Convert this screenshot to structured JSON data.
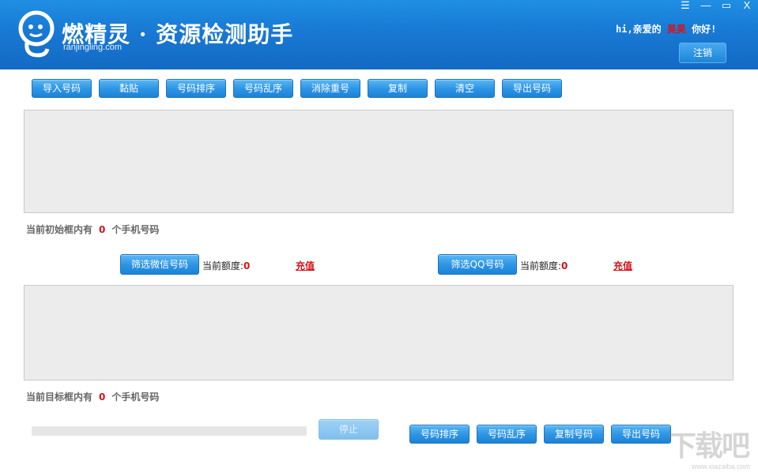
{
  "app": {
    "brand_name": "燃精灵 · 资源检测助手",
    "brand_domain": "ranjingling.com",
    "greeting_prefix": "hi,亲爱的",
    "username": "昊昊",
    "greeting_suffix": "你好!",
    "logout_label": "注销",
    "window_controls": {
      "menu": "☰",
      "minimize": "—",
      "maximize": "▭",
      "close": "X"
    }
  },
  "toolbar": {
    "import": "导入号码",
    "paste": "黏贴",
    "sort": "号码排序",
    "shuffle": "号码乱序",
    "dedupe": "消除重号",
    "copy": "复制",
    "clear": "清空",
    "export": "导出号码"
  },
  "source": {
    "textarea_value": "",
    "status_prefix": "当前初始框内有",
    "count": "0",
    "status_suffix": "个手机号码"
  },
  "filters": {
    "wechat_button": "筛选微信号码",
    "qq_button": "筛选QQ号码",
    "quota_label": "当前额度:",
    "wechat_quota": "0",
    "qq_quota": "0",
    "recharge_label": "充值"
  },
  "target": {
    "textarea_value": "",
    "status_prefix": "当前目标框内有",
    "count": "0",
    "status_suffix": "个手机号码"
  },
  "bottom": {
    "progress": 0,
    "stop": "停止",
    "sort": "号码排序",
    "shuffle": "号码乱序",
    "copy": "复制号码",
    "export": "导出号码"
  },
  "watermark": {
    "text": "下载吧",
    "url": "www.xiazaiba.com"
  },
  "colors": {
    "titlebar": "#1879d4",
    "button": "#2f96e6",
    "accent_red": "#d4141c",
    "textarea_bg": "#ececec"
  }
}
